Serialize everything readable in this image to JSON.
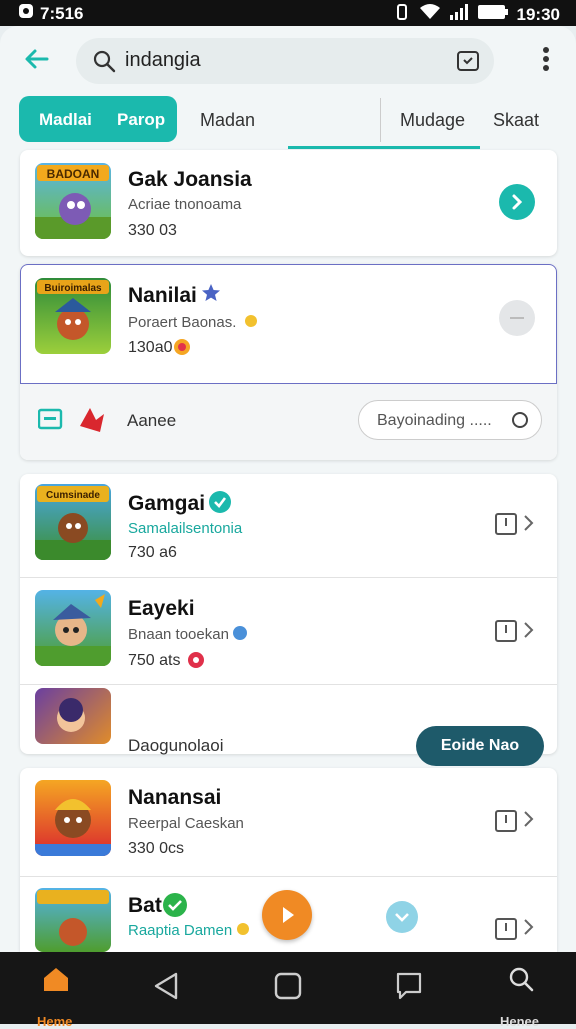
{
  "status": {
    "time_left": "7:516",
    "time_right": "19:30"
  },
  "search": {
    "query": "indangia"
  },
  "tabs": {
    "active": [
      "Madlai",
      "Parop"
    ],
    "others": [
      "Madan",
      "Mudage",
      "Skaat"
    ]
  },
  "cards": [
    {
      "title": "Gak Joansia",
      "subtitle": "Acriae tnonoama",
      "count": "330 03",
      "thumb_text": "BADOAN"
    },
    {
      "title": "Nanilai",
      "subtitle": "Poraert Baonas.",
      "count": "130a0",
      "thumb_text": "Buiroimalas"
    },
    {
      "title": "Gamgai",
      "subtitle": "Samalailsentonia",
      "count": "730 a6",
      "thumb_text": "Cumsinade"
    },
    {
      "title": "Eayeki",
      "subtitle": "Bnaan tooekan",
      "count": "750 ats"
    },
    {
      "title": "Nanansai",
      "subtitle": "Reerpal Caeskan",
      "count": "330 0cs"
    },
    {
      "title": "Bat",
      "subtitle": "Raaptia Damen"
    }
  ],
  "expanded": {
    "label": "Aanee",
    "placeholder": "Bayoinading ....."
  },
  "promo": {
    "label": "Daogunolaoi",
    "button": "Eoide Nao"
  },
  "nav": {
    "home": "Heme",
    "search": "Henee"
  },
  "colors": {
    "teal": "#1bb9ad",
    "dark_teal": "#1e5a6a",
    "orange": "#f08a24"
  }
}
